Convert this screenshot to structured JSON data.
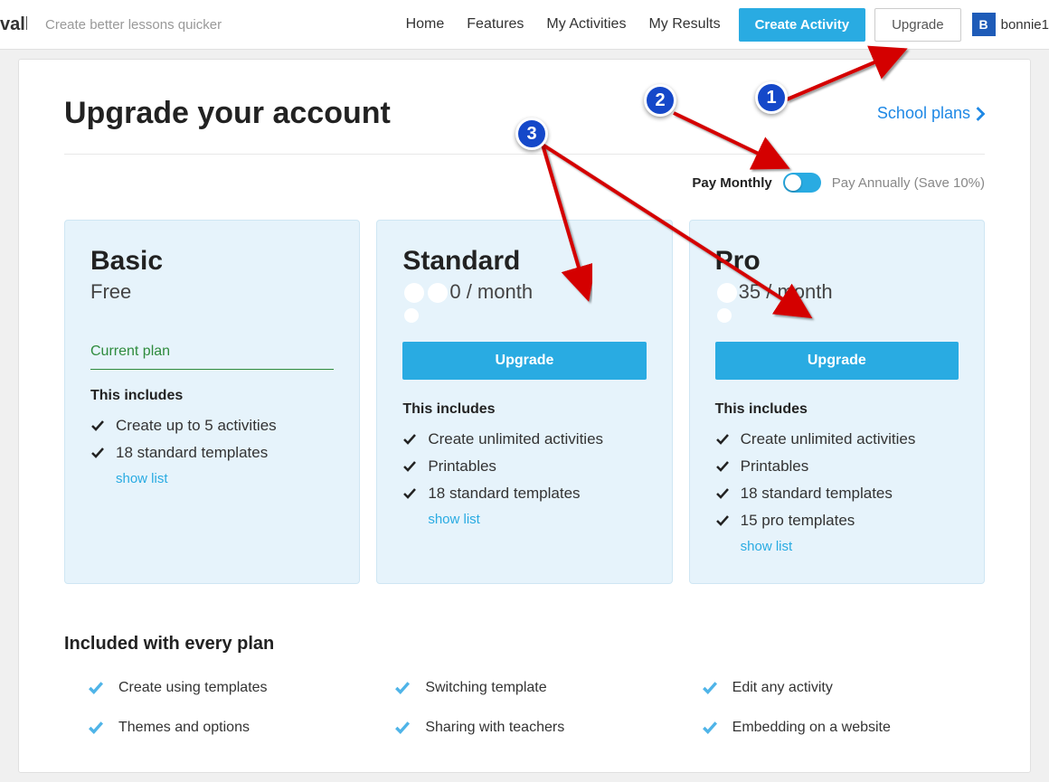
{
  "header": {
    "logo_fragment": "vall",
    "tagline": "Create better lessons quicker",
    "nav": [
      "Home",
      "Features",
      "My Activities",
      "My Results"
    ],
    "create_btn": "Create Activity",
    "upgrade_btn": "Upgrade",
    "user_initial": "B",
    "user_name": "bonnie1"
  },
  "page": {
    "title": "Upgrade your account",
    "school_link": "School plans",
    "toggle": {
      "left": "Pay Monthly",
      "right": "Pay Annually (Save 10%)"
    }
  },
  "plans": [
    {
      "name": "Basic",
      "price": "Free",
      "sub": "",
      "current_label": "Current plan",
      "is_current": true,
      "includes_title": "This includes",
      "features": [
        "Create up to 5 activities",
        "18 standard templates"
      ],
      "show_list": "show list"
    },
    {
      "name": "Standard",
      "price_suffix": " / month",
      "sub_hidden": true,
      "upgrade_label": "Upgrade",
      "includes_title": "This includes",
      "features": [
        "Create unlimited activities",
        "Printables",
        "18 standard templates"
      ],
      "show_list": "show list"
    },
    {
      "name": "Pro",
      "price_mid": "35",
      "price_suffix": " / month",
      "sub_hidden": true,
      "upgrade_label": "Upgrade",
      "includes_title": "This includes",
      "features": [
        "Create unlimited activities",
        "Printables",
        "18 standard templates",
        "15 pro templates"
      ],
      "show_list": "show list"
    }
  ],
  "included": {
    "title": "Included with every plan",
    "items": [
      "Create using templates",
      "Switching template",
      "Edit any activity",
      "Themes and options",
      "Sharing with teachers",
      "Embedding on a website"
    ]
  },
  "annotations": {
    "1": "1",
    "2": "2",
    "3": "3"
  }
}
